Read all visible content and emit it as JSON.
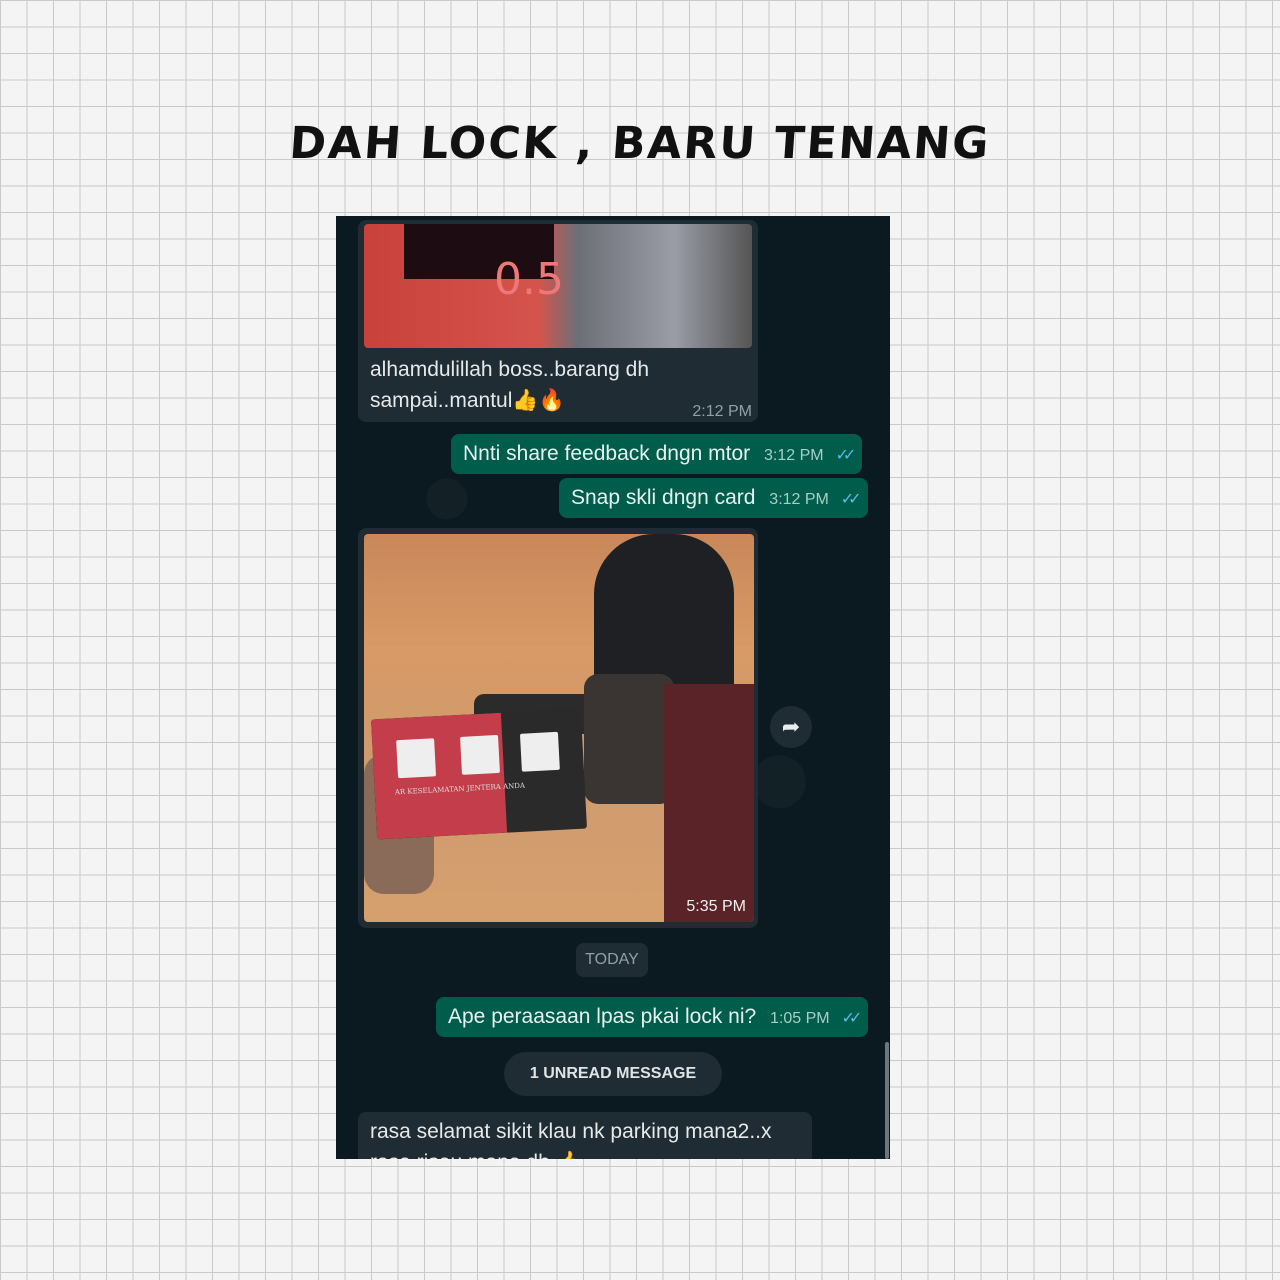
{
  "title": "DAH LOCK , BARU TENANG",
  "chat": {
    "msg1": {
      "line1": "alhamdulillah boss..barang dh",
      "line2": "sampai..mantul👍🔥",
      "time": "2:12 PM"
    },
    "msg2": {
      "text": "Nnti share feedback dngn mtor",
      "time": "3:12 PM"
    },
    "msg3": {
      "text": "Snap skli dngn card",
      "time": "3:12 PM"
    },
    "photo": {
      "time": "5:35 PM",
      "card_caption": "AR KESELAMATAN JENTERA ANDA"
    },
    "date_divider": "TODAY",
    "msg4": {
      "text": "Ape peraasaan lpas pkai lock ni?",
      "time": "1:05 PM"
    },
    "unread": "1 UNREAD MESSAGE",
    "msg5": {
      "line1": "rasa selamat sikit klau nk parking mana2..x",
      "line2": "rasa risau mana dh 👍"
    }
  },
  "icons": {
    "share": "share-icon",
    "ticks": "double-check-icon"
  },
  "colors": {
    "incoming": "#1f2c33",
    "outgoing": "#005c4b",
    "ticks": "#53bdeb",
    "background": "#0b1a20"
  }
}
